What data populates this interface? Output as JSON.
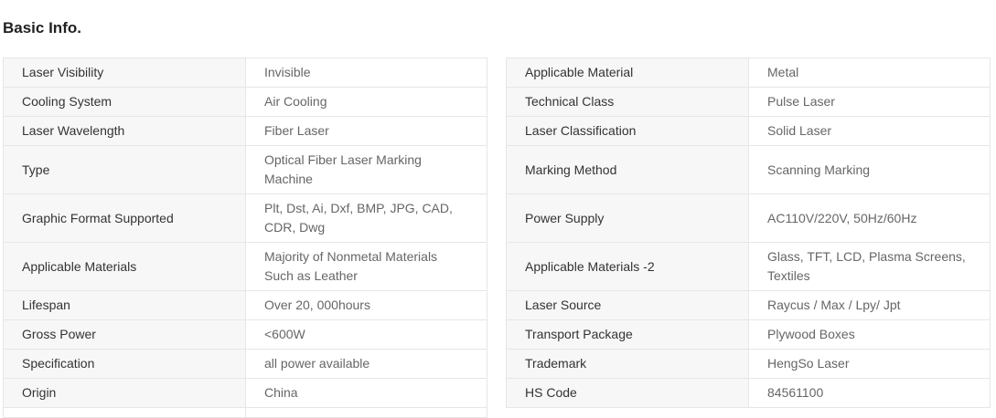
{
  "section": {
    "title": "Basic Info."
  },
  "left_table": [
    {
      "label": "Laser Visibility",
      "value": "Invisible"
    },
    {
      "label": "Cooling System",
      "value": "Air Cooling"
    },
    {
      "label": "Laser Wavelength",
      "value": "Fiber Laser"
    },
    {
      "label": "Type",
      "value": "Optical Fiber Laser Marking Machine"
    },
    {
      "label": "Graphic Format Supported",
      "value": "Plt, Dst, Ai, Dxf, BMP, JPG, CAD, CDR, Dwg"
    },
    {
      "label": "Applicable Materials",
      "value": "Majority of Nonmetal Materials Such as Leather"
    },
    {
      "label": "Lifespan",
      "value": "Over 20, 000hours"
    },
    {
      "label": "Gross Power",
      "value": "<600W"
    },
    {
      "label": "Specification",
      "value": "all power available"
    },
    {
      "label": "Origin",
      "value": "China"
    }
  ],
  "right_table": [
    {
      "label": "Applicable Material",
      "value": "Metal"
    },
    {
      "label": "Technical Class",
      "value": "Pulse Laser"
    },
    {
      "label": "Laser Classification",
      "value": "Solid Laser"
    },
    {
      "label": "Marking Method",
      "value": "Scanning Marking"
    },
    {
      "label": "Power Supply",
      "value": "AC110V/220V, 50Hz/60Hz"
    },
    {
      "label": "Applicable Materials -2",
      "value": "Glass, TFT, LCD, Plasma Screens, Textiles"
    },
    {
      "label": "Laser Source",
      "value": "Raycus / Max / Lpy/ Jpt"
    },
    {
      "label": "Transport Package",
      "value": "Plywood Boxes"
    },
    {
      "label": "Trademark",
      "value": "HengSo Laser"
    },
    {
      "label": "HS Code",
      "value": "84561100"
    }
  ]
}
